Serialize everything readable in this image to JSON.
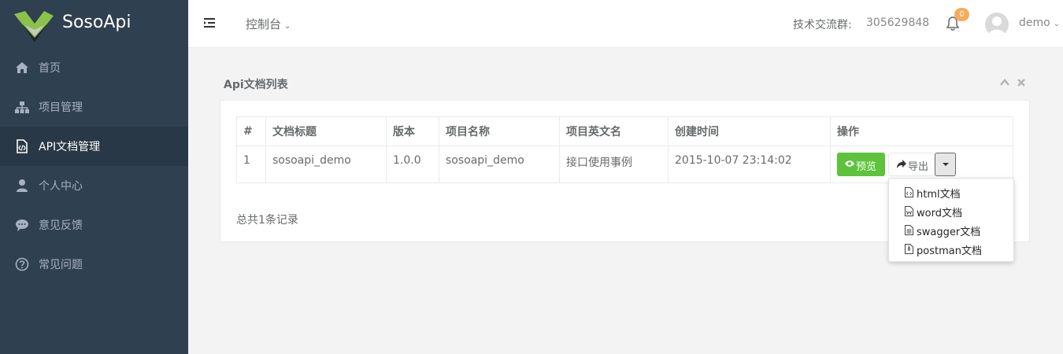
{
  "brand": {
    "name": "SosoApi"
  },
  "sidebar": {
    "items": [
      {
        "label": "首页",
        "icon": "home-icon"
      },
      {
        "label": "项目管理",
        "icon": "sitemap-icon"
      },
      {
        "label": "API文档管理",
        "icon": "file-code-icon",
        "active": true
      },
      {
        "label": "个人中心",
        "icon": "user-icon"
      },
      {
        "label": "意见反馈",
        "icon": "comment-icon"
      },
      {
        "label": "常见问题",
        "icon": "question-circle-icon"
      }
    ]
  },
  "topbar": {
    "console": "控制台",
    "tech_group_label": "技术交流群:",
    "tech_group_number": "305629848",
    "notification_count": "0",
    "username": "demo"
  },
  "panel": {
    "title": "Api文档列表"
  },
  "table": {
    "headers": [
      "#",
      "文档标题",
      "版本",
      "项目名称",
      "项目英文名",
      "创建时间",
      "操作"
    ],
    "rows": [
      [
        "1",
        "sosoapi_demo",
        "1.0.0",
        "sosoapi_demo",
        "接口使用事例",
        "2015-10-07 23:14:02"
      ]
    ]
  },
  "actions": {
    "preview": "预览",
    "export": "导出"
  },
  "export_menu": {
    "items": [
      "html文档",
      "word文档",
      "swagger文档",
      "postman文档"
    ]
  },
  "total_records": "总共1条记录",
  "colors": {
    "sidebar_bg": "#2f4050",
    "sidebar_active_bg": "#293846",
    "preview_green": "#5cc33b",
    "badge_orange": "#f8ac59"
  }
}
